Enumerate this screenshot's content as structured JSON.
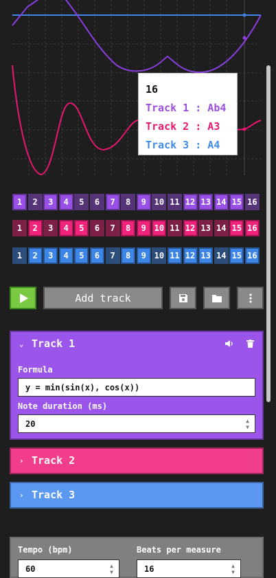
{
  "tooltip": {
    "title": "16",
    "rows": [
      {
        "text": "Track 1 : Ab4",
        "color": "#9b4fe0"
      },
      {
        "text": "Track 2 : A3",
        "color": "#e8176e"
      },
      {
        "text": "Track 3 : A4",
        "color": "#3f8ae6"
      }
    ]
  },
  "sequencers": [
    {
      "track": "Track 1",
      "color": "#9950e6",
      "active": [
        true,
        false,
        true,
        true,
        false,
        false,
        true,
        false,
        true,
        false,
        false,
        true,
        true,
        true,
        true,
        false
      ]
    },
    {
      "track": "Track 2",
      "color": "#f2237a",
      "active": [
        false,
        true,
        false,
        true,
        true,
        false,
        false,
        true,
        true,
        true,
        false,
        true,
        false,
        false,
        true,
        true
      ]
    },
    {
      "track": "Track 3",
      "color": "#3d86e8",
      "active": [
        false,
        true,
        true,
        true,
        true,
        true,
        false,
        true,
        true,
        false,
        true,
        true,
        true,
        false,
        true,
        true
      ]
    }
  ],
  "step_labels": [
    "1",
    "2",
    "3",
    "4",
    "5",
    "6",
    "7",
    "8",
    "9",
    "10",
    "11",
    "12",
    "13",
    "14",
    "15",
    "16"
  ],
  "toolbar": {
    "add_track": "Add track"
  },
  "tracks": [
    {
      "name": "Track 1",
      "expanded": true,
      "color": "#9b55ea",
      "formula_label": "Formula",
      "formula": "y = min(sin(x), cos(x))",
      "duration_label": "Note duration (ms)",
      "duration": "20"
    },
    {
      "name": "Track 2",
      "expanded": false,
      "color": "#f23d8a"
    },
    {
      "name": "Track 3",
      "expanded": false,
      "color": "#5a98f2"
    }
  ],
  "settings": {
    "tempo_label": "Tempo (bpm)",
    "tempo": "60",
    "beats_label": "Beats per measure",
    "beats": "16"
  }
}
